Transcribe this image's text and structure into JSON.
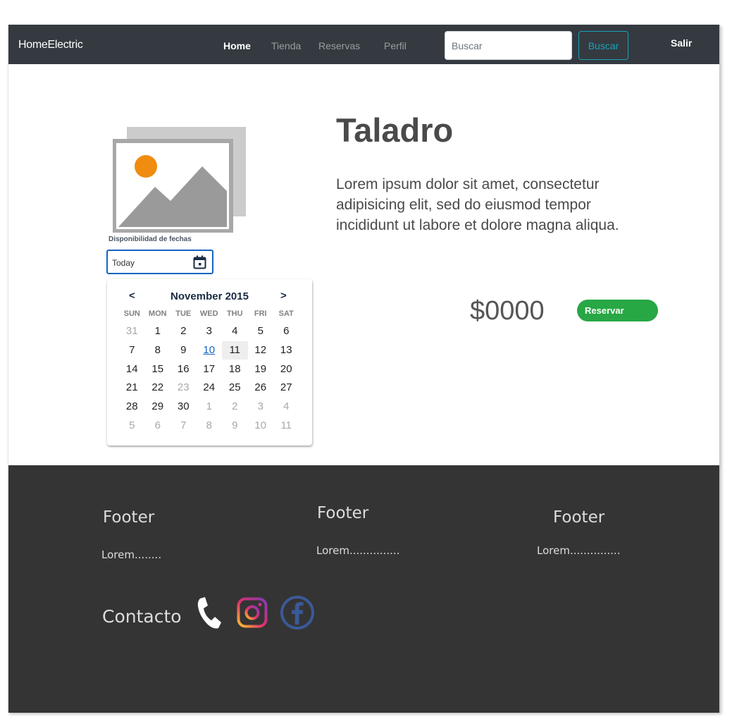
{
  "navbar": {
    "brand": "HomeElectric",
    "links": [
      "Home",
      "Tienda",
      "Reservas",
      "Perfil"
    ],
    "active_link": "Home",
    "search_placeholder": "Buscar",
    "search_button": "Buscar",
    "logout": "Salir"
  },
  "product": {
    "title": "Taladro",
    "description": "Lorem ipsum dolor sit amet, consectetur adipisicing elit, sed do eiusmod tempor incididunt ut labore et dolore magna aliqua.",
    "price": "$0000",
    "reserve_button": "Reservar",
    "icon": "image-placeholder-icon"
  },
  "availability": {
    "label": "Disponibilidad de fechas",
    "date_value": "Today",
    "icon": "calendar-icon"
  },
  "calendar": {
    "prev": "<",
    "next": ">",
    "month_title": "November 2015",
    "weekdays": [
      "SUN",
      "MON",
      "TUE",
      "WED",
      "THU",
      "FRI",
      "SAT"
    ],
    "weeks": [
      [
        "31",
        "1",
        "2",
        "3",
        "4",
        "5",
        "6"
      ],
      [
        "7",
        "8",
        "9",
        "10",
        "11",
        "12",
        "13"
      ],
      [
        "14",
        "15",
        "16",
        "17",
        "18",
        "19",
        "20"
      ],
      [
        "21",
        "22",
        "23",
        "24",
        "25",
        "26",
        "27"
      ],
      [
        "28",
        "29",
        "30",
        "1",
        "2",
        "3",
        "4"
      ],
      [
        "5",
        "6",
        "7",
        "8",
        "9",
        "10",
        "11"
      ]
    ],
    "today": "10",
    "selected": "11",
    "disabled": [
      "23"
    ]
  },
  "footer": {
    "columns": [
      {
        "heading": "Footer",
        "text": "Lorem........"
      },
      {
        "heading": "Footer",
        "text": "Lorem..............."
      },
      {
        "heading": "Footer",
        "text": "Lorem..............."
      }
    ],
    "contact_label": "Contacto",
    "social_icons": [
      "phone-icon",
      "instagram-icon",
      "facebook-icon"
    ]
  },
  "colors": {
    "navbar_bg": "#343a40",
    "footer_bg": "#343434",
    "accent_teal": "#17a2b8",
    "reserve_green": "#28a745",
    "calendar_blue": "#1565c0",
    "facebook_blue": "#3b5998"
  }
}
